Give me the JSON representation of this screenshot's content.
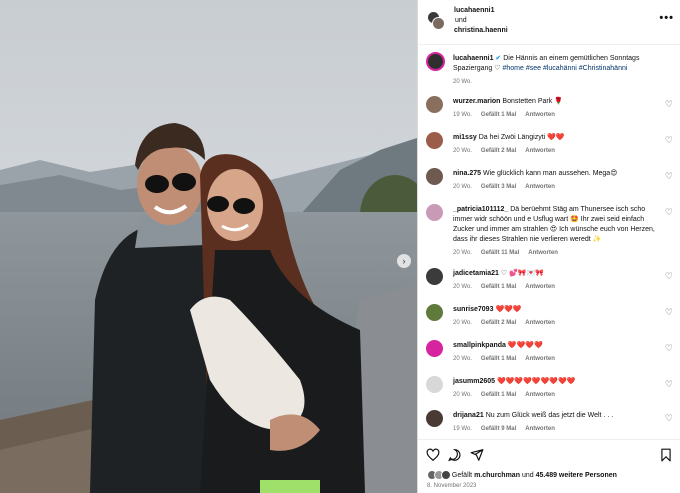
{
  "header": {
    "user1": "lucahaenni1",
    "connector": "und",
    "user2": "christina.haenni"
  },
  "caption": {
    "user": "lucahaenni1",
    "text": "Die Hännis an einem gemütlichen Sonntags Spaziergang ♡ ",
    "tags": "#home #see #lucahänni #Christinahänni",
    "time": "20 Wo."
  },
  "comments": [
    {
      "user": "wurzer.marion",
      "text": "Bonstetten Park 🌹",
      "time": "19 Wo.",
      "likes": "Gefällt 1 Mal",
      "reply": "Antworten"
    },
    {
      "user": "mi1ssy",
      "text": "Da hei Zwöi Längizyti ❤️❤️",
      "time": "20 Wo.",
      "likes": "Gefällt 2 Mal",
      "reply": "Antworten"
    },
    {
      "user": "nina.275",
      "text": "Wie glücklich kann man aussehen. Mega😍",
      "time": "20 Wo.",
      "likes": "Gefällt 3 Mal",
      "reply": "Antworten"
    },
    {
      "user": "_patricia101112_",
      "text": "Dä berüehmt Stäg am Thunersee isch scho immer widr schöön und e Usflug wart 🤩 Ihr zwei seid einfach Zucker und immer am strahlen 😍 Ich wünsche euch von Herzen, dass ihr dieses Strahlen nie verlieren weredt ✨",
      "time": "20 Wo.",
      "likes": "Gefällt 11 Mal",
      "reply": "Antworten"
    },
    {
      "user": "jadicetamia21",
      "text": "♡ 💕🎀💌🎀",
      "time": "20 Wo.",
      "likes": "Gefällt 1 Mal",
      "reply": "Antworten"
    },
    {
      "user": "sunrise7093",
      "text": "❤️❤️❤️",
      "time": "20 Wo.",
      "likes": "Gefällt 2 Mal",
      "reply": "Antworten"
    },
    {
      "user": "smallpinkpanda",
      "text": "❤️❤️❤️❤️",
      "time": "20 Wo.",
      "likes": "Gefällt 1 Mal",
      "reply": "Antworten"
    },
    {
      "user": "jasumm2605",
      "text": "❤️❤️❤️❤️❤️❤️❤️❤️❤️",
      "time": "20 Wo.",
      "likes": "Gefällt 1 Mal",
      "reply": "Antworten"
    },
    {
      "user": "drijana21",
      "text": "Nu zum Glück weiß das jetzt die Welt . . .",
      "time": "19 Wo.",
      "likes": "Gefällt 9 Mal",
      "reply": "Antworten"
    }
  ],
  "footer": {
    "likes_prefix": "Gefällt",
    "likes_user": "m.churchman",
    "likes_and": "und",
    "likes_count": "45.489 weitere Personen",
    "date": "8. November 2023"
  },
  "icons": {
    "like": "heart-icon",
    "comment": "comment-icon",
    "share": "share-icon",
    "save": "bookmark-icon",
    "more": "more-icon",
    "next": "chevron-right-icon"
  },
  "colors": {
    "link": "#00376b",
    "meta": "#737373",
    "story_ring": "#d6249f"
  }
}
